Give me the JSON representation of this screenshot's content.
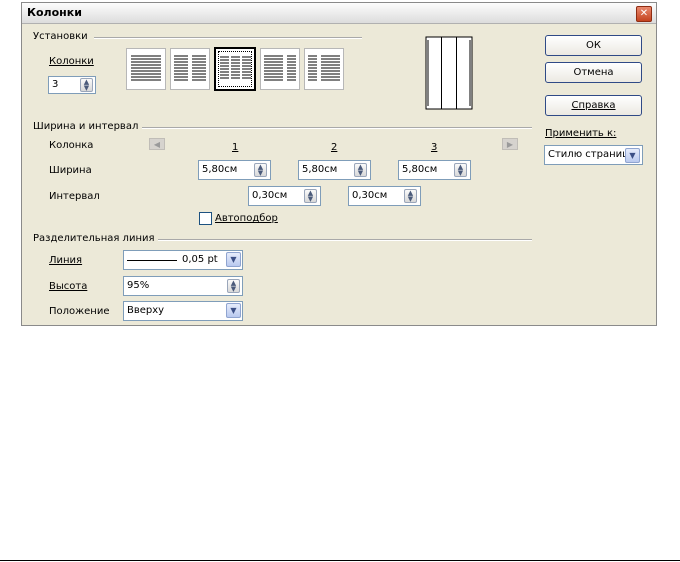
{
  "window": {
    "title": "Колонки",
    "close_glyph": "✕"
  },
  "settings": {
    "group_label": "Установки",
    "columns_label": "Колонки",
    "columns_value": "3",
    "presets": [
      "1 колонка",
      "2 колонки",
      "3 колонки",
      "2 колонки (широкая левая)",
      "2 колонки (широкая правая)"
    ],
    "selected_preset": 2
  },
  "width_spacing": {
    "group_label": "Ширина и интервал",
    "column_label": "Колонка",
    "width_label": "Ширина",
    "spacing_label": "Интервал",
    "column_numbers": [
      "1",
      "2",
      "3"
    ],
    "widths": [
      "5,80см",
      "5,80см",
      "5,80см"
    ],
    "spacings": [
      "0,30см",
      "0,30см"
    ],
    "autofit_label": "Автоподбор"
  },
  "separator": {
    "group_label": "Разделительная линия",
    "line_label": "Линия",
    "line_value": "0,05 pt",
    "height_label": "Высота",
    "height_value": "95%",
    "position_label": "Положение",
    "position_value": "Вверху"
  },
  "buttons": {
    "ok": "ОК",
    "cancel": "Отмена",
    "help": "Справка"
  },
  "apply_to": {
    "label": "Применить к:",
    "value": "Стилю страниц"
  }
}
